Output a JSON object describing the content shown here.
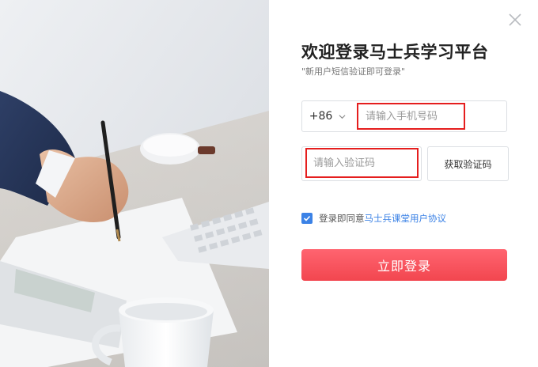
{
  "dialog": {
    "title": "欢迎登录马士兵学习平台",
    "subtitle": "\"新用户短信验证即可登录\""
  },
  "phone": {
    "country_code": "+86",
    "placeholder": "请输入手机号码",
    "value": ""
  },
  "code": {
    "placeholder": "请输入验证码",
    "value": "",
    "get_code_label": "获取验证码"
  },
  "agreement": {
    "checked": true,
    "prefix": "登录即同意",
    "link_text": "马士兵课堂用户协议"
  },
  "login_button": "立即登录",
  "colors": {
    "accent_red": "#f2464f",
    "link_blue": "#3b82e6",
    "highlight_border": "#e51e1e"
  }
}
